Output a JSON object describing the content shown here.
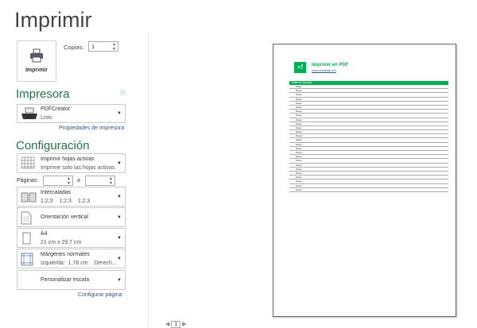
{
  "header": {
    "title": "Imprimir"
  },
  "print": {
    "button_label": "Imprimir",
    "copies_label": "Copias:",
    "copies_value": "1"
  },
  "printer": {
    "section": "Impresora",
    "name": "PDFCreator",
    "status": "Listo",
    "properties_link": "Propiedades de impresora",
    "info_icon": "info-icon"
  },
  "settings": {
    "section": "Configuración",
    "sheets": {
      "title": "Imprimir hojas activas",
      "subtitle": "Imprime solo las hojas activas"
    },
    "pages_label": "Páginas:",
    "pages_to": "a",
    "collate": {
      "title": "Intercaladas",
      "subtitle": "1;2;3    1;2;3    1;2;3"
    },
    "orientation": {
      "title": "Orientación vertical"
    },
    "paper": {
      "title": "A4",
      "subtitle": "21 cm x 29,7 cm"
    },
    "margins": {
      "title": "Márgenes normales",
      "subtitle": "Izquierda:  1,78 cm    Derech..."
    },
    "scale": {
      "title": "Personalizar escala"
    },
    "page_setup_link": "Configurar página"
  },
  "preview": {
    "logo": "=f",
    "doc_title": "Imprimir en PDF",
    "doc_link": "www.exceltotal.com",
    "table_header": "Tabla de ejemplo",
    "row_label": "Datos",
    "row_count": 26,
    "accent": "#00b050"
  },
  "nav": {
    "page": "1"
  }
}
